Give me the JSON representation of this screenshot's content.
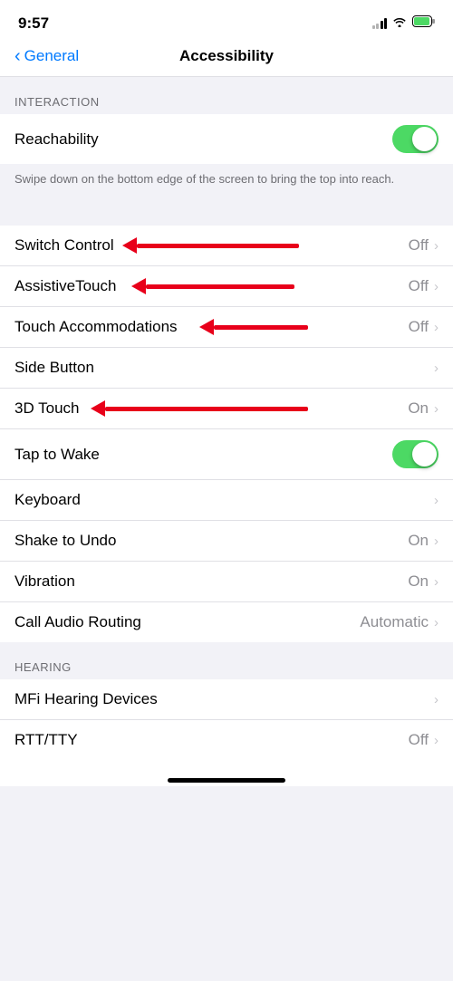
{
  "statusBar": {
    "time": "9:57",
    "icons": {
      "signal": "signal-icon",
      "wifi": "wifi-icon",
      "battery": "battery-icon"
    }
  },
  "navBar": {
    "backLabel": "General",
    "title": "Accessibility"
  },
  "sections": [
    {
      "id": "interaction",
      "header": "INTERACTION",
      "items": [
        {
          "id": "reachability",
          "label": "Reachability",
          "type": "toggle",
          "toggleState": "on",
          "hasArrow": false
        }
      ]
    },
    {
      "id": "description",
      "text": "Swipe down on the bottom edge of the screen to bring the top into reach."
    },
    {
      "id": "interaction2",
      "items": [
        {
          "id": "switch-control",
          "label": "Switch Control",
          "type": "value-chevron",
          "value": "Off",
          "hasRedArrow": true,
          "arrowWidth": 190
        },
        {
          "id": "assistive-touch",
          "label": "AssistiveTouch",
          "type": "value-chevron",
          "value": "Off",
          "hasRedArrow": true,
          "arrowWidth": 180
        },
        {
          "id": "touch-accommodations",
          "label": "Touch Accommodations",
          "type": "value-chevron",
          "value": "Off",
          "hasRedArrow": true,
          "arrowWidth": 155
        },
        {
          "id": "side-button",
          "label": "Side Button",
          "type": "chevron",
          "hasRedArrow": false
        },
        {
          "id": "3d-touch",
          "label": "3D Touch",
          "type": "value-chevron",
          "value": "On",
          "hasRedArrow": true,
          "arrowWidth": 220
        },
        {
          "id": "tap-to-wake",
          "label": "Tap to Wake",
          "type": "toggle",
          "toggleState": "on",
          "hasRedArrow": false
        },
        {
          "id": "keyboard",
          "label": "Keyboard",
          "type": "chevron",
          "hasRedArrow": false
        },
        {
          "id": "shake-to-undo",
          "label": "Shake to Undo",
          "type": "value-chevron",
          "value": "On",
          "hasRedArrow": false
        },
        {
          "id": "vibration",
          "label": "Vibration",
          "type": "value-chevron",
          "value": "On",
          "hasRedArrow": false
        },
        {
          "id": "call-audio-routing",
          "label": "Call Audio Routing",
          "type": "value-chevron",
          "value": "Automatic",
          "hasRedArrow": false
        }
      ]
    }
  ],
  "hearingSection": {
    "header": "HEARING",
    "items": [
      {
        "id": "mfi-hearing-devices",
        "label": "MFi Hearing Devices",
        "type": "chevron",
        "hasRedArrow": false
      },
      {
        "id": "rtt-tty",
        "label": "RTT/TTY",
        "type": "value-chevron",
        "value": "Off",
        "hasRedArrow": false
      }
    ]
  }
}
